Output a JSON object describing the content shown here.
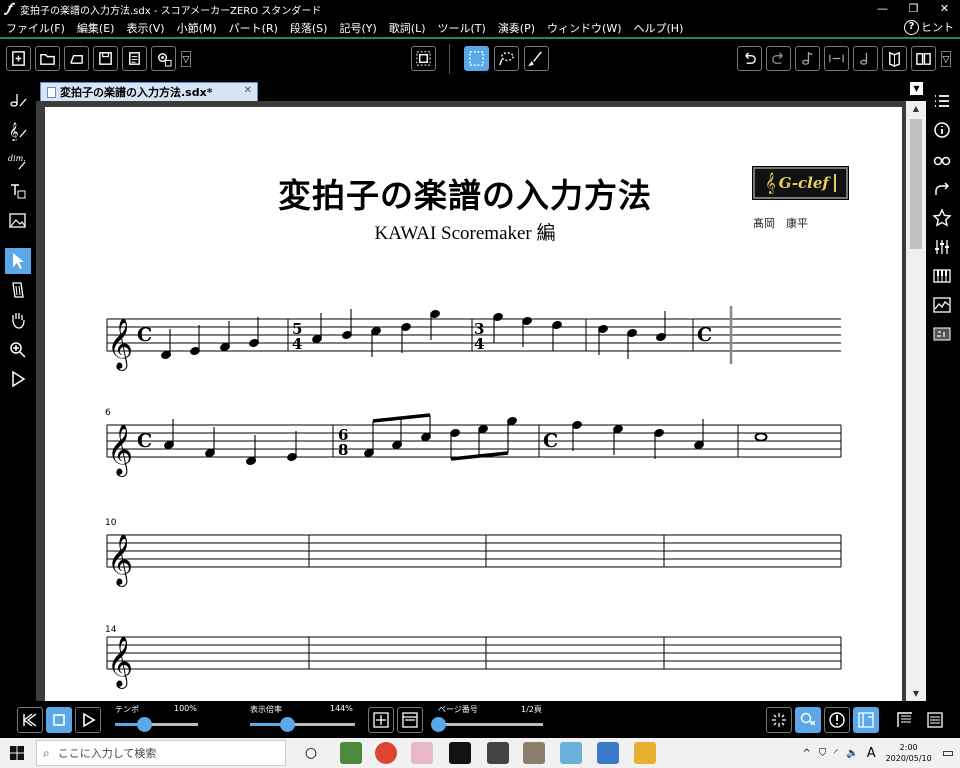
{
  "window": {
    "title": "変拍子の楽譜の入力方法.sdx - スコアメーカーZERO スタンダード"
  },
  "menubar": {
    "items": [
      "ファイル(F)",
      "編集(E)",
      "表示(V)",
      "小節(M)",
      "パート(R)",
      "段落(S)",
      "記号(Y)",
      "歌詞(L)",
      "ツール(T)",
      "演奏(P)",
      "ウィンドウ(W)",
      "ヘルプ(H)"
    ],
    "hint": "ヒント"
  },
  "tab": {
    "label": "変拍子の楽譜の入力方法.sdx*"
  },
  "score": {
    "title": "変拍子の楽譜の入力方法",
    "subtitle": "KAWAI Scoremaker 編",
    "composer": "髙岡　康平",
    "logo_text": "G-clef",
    "measure_numbers": [
      "6",
      "10",
      "14"
    ]
  },
  "bottombar": {
    "tempo_label": "テンポ",
    "tempo_value": "100%",
    "tempo_level": 0.35,
    "zoom_label": "表示倍率",
    "zoom_value": "144%",
    "zoom_level": 0.35,
    "page_label": "ページ番号",
    "page_value": "1/2頁",
    "page_level": 0.0
  },
  "taskbar": {
    "search_placeholder": "ここに入力して検索",
    "time": "2:00",
    "date": "2020/05/10",
    "ime": "A"
  },
  "colors": {
    "accent": "#5aa8e8",
    "toolbar_bg": "#000000",
    "workspace_bg": "#3c3c3c",
    "page_bg": "#ffffff",
    "logo_text": "#e8d060"
  }
}
